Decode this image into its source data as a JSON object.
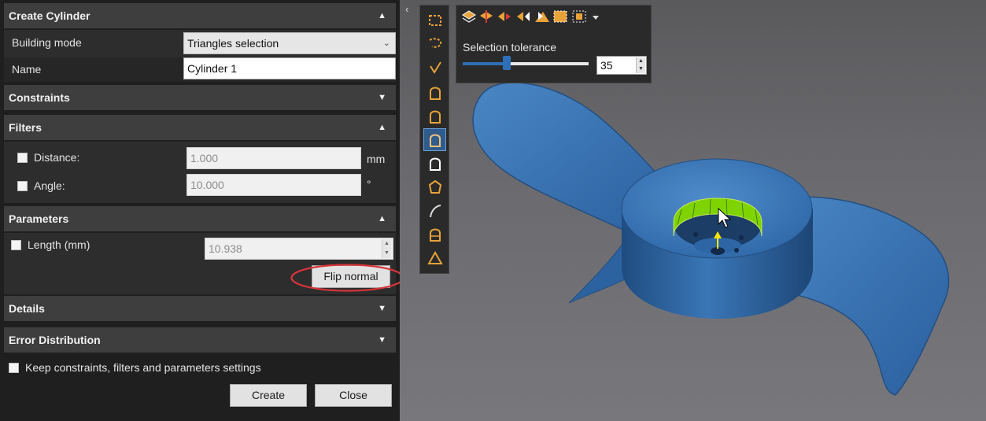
{
  "panel": {
    "title": "Create Cylinder",
    "building_mode_label": "Building mode",
    "building_mode_value": "Triangles selection",
    "name_label": "Name",
    "name_value": "Cylinder 1",
    "constraints_header": "Constraints",
    "filters_header": "Filters",
    "distance_label": "Distance:",
    "distance_value": "1.000",
    "distance_unit": "mm",
    "angle_label": "Angle:",
    "angle_value": "10.000",
    "angle_unit": "°",
    "parameters_header": "Parameters",
    "length_label": "Length (mm)",
    "length_value": "10.938",
    "flip_normal_label": "Flip normal",
    "details_header": "Details",
    "error_distribution_header": "Error Distribution",
    "keep_settings_label": "Keep constraints, filters and parameters settings",
    "create_label": "Create",
    "close_label": "Close"
  },
  "selection_toolbar": {
    "tolerance_label": "Selection tolerance",
    "tolerance_value": "35",
    "tolerance_fraction": 0.35
  },
  "colors": {
    "accent": "#2f6fb7",
    "highlight_ring": "#d8343a",
    "selection_green": "#7fd300",
    "tool_orange": "#e8a23a"
  },
  "icons": {
    "tools_left": [
      "rectangle-select-icon",
      "lasso-select-icon",
      "brush-select-icon",
      "cylinder-select-icon",
      "cylinder-select-2-icon",
      "cylinder-select-active-icon",
      "cylinder-outline-icon",
      "circle-select-icon",
      "curve-select-icon",
      "cylinder-select-3-icon",
      "triangle-select-icon"
    ],
    "tools_top": [
      "layers-select-icon",
      "layers-swap-icon",
      "expand-select-icon",
      "shrink-select-icon",
      "grow-select-icon",
      "select-all-icon",
      "invert-select-icon",
      "dropdown-arrow-icon"
    ]
  }
}
